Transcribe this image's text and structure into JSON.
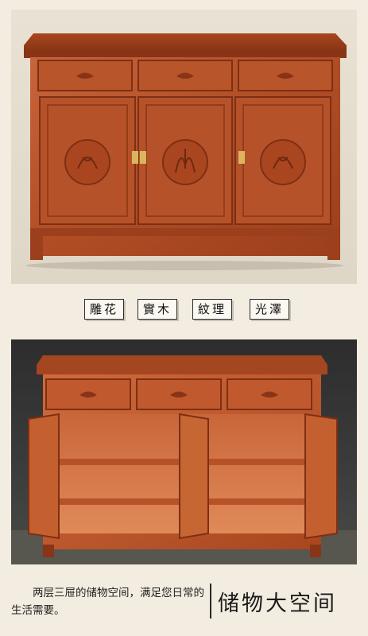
{
  "features": [
    "雕花",
    "實木",
    "紋理",
    "光澤"
  ],
  "caption": "两层三屉的储物空间，满足您日常的生活需要。",
  "headline": "储物大空间",
  "colors": {
    "background": "#f3ece0",
    "wood": "#b5532a",
    "wood_dark": "#7e2f14"
  }
}
